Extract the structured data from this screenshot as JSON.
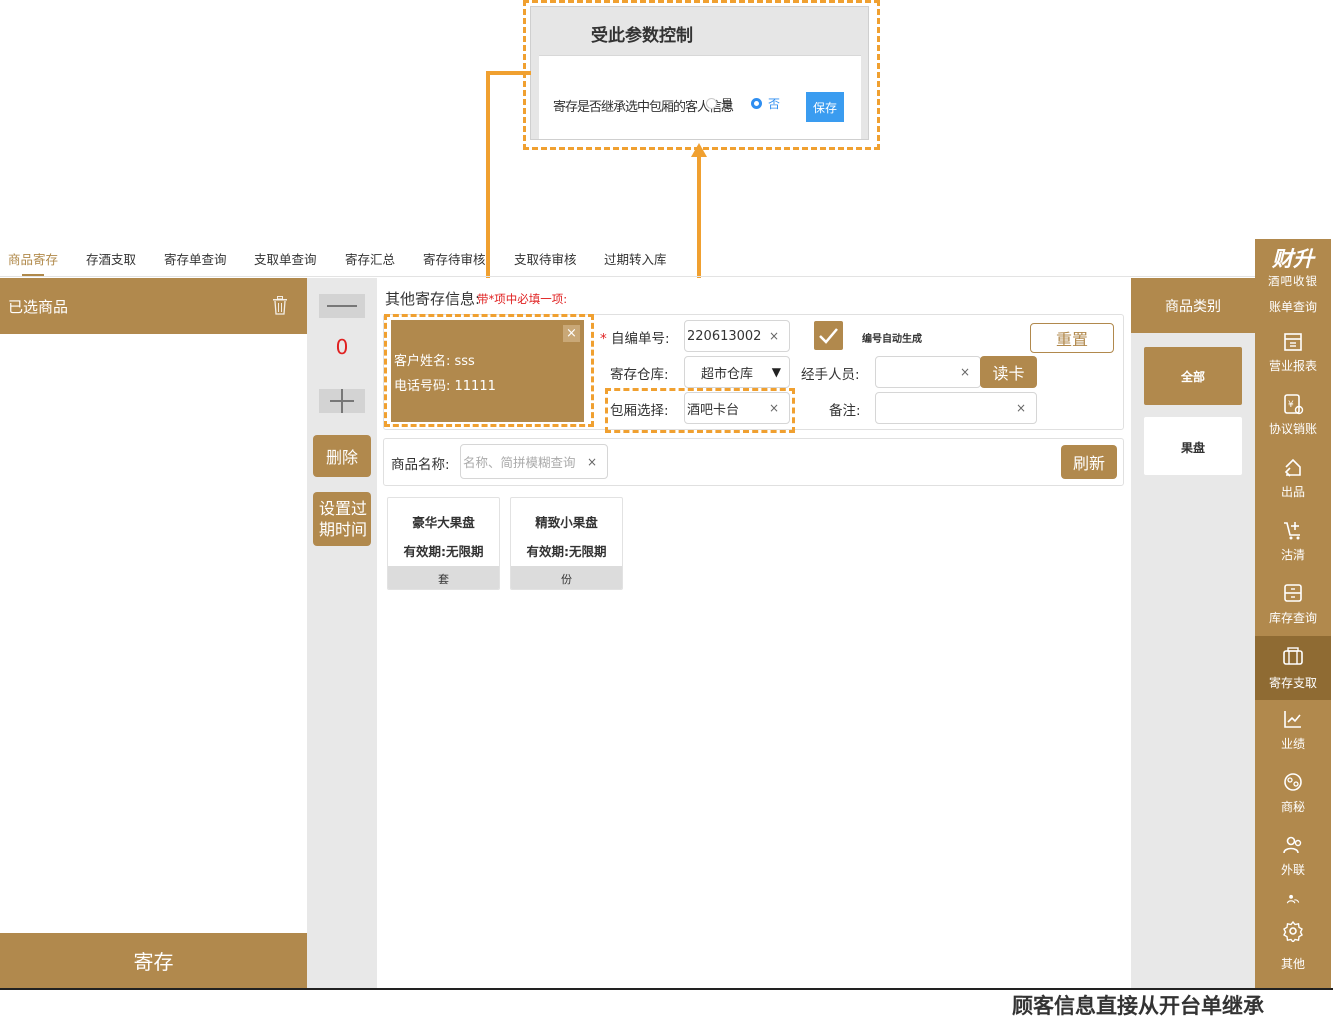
{
  "popup": {
    "title": "受此参数控制",
    "question": "寄存是否继承选中包厢的客人信息",
    "option_yes": "是",
    "option_no": "否",
    "selected": "否",
    "save_label": "保存"
  },
  "tabs": [
    "商品寄存",
    "存酒支取",
    "寄存单查询",
    "支取单查询",
    "寄存汇总",
    "寄存待审核",
    "支取待审核",
    "过期转入库"
  ],
  "active_tab": "商品寄存",
  "left_panel": {
    "title": "已选商品",
    "footer_button": "寄存"
  },
  "quantity": {
    "minus": "—",
    "value": "0",
    "plus": "+"
  },
  "actions": {
    "delete": "删除",
    "set_expire": "设置过期时间"
  },
  "form": {
    "section_title": "其他寄存信息:",
    "hint": "带*项中必填一项:",
    "customer": {
      "name_line": "客户姓名:  sss",
      "phone_line": "电话号码:  11111",
      "close": "×"
    },
    "serial_required": "*",
    "serial_label": "自编单号:",
    "serial_value": "220613002",
    "auto_generate_label": "编号自动生成",
    "auto_generate_checked": true,
    "reset_label": "重置",
    "warehouse_label": "寄存仓库:",
    "warehouse_value": "超市仓库",
    "handler_label": "经手人员:",
    "handler_value": "",
    "read_card_label": "读卡",
    "room_label": "包厢选择:",
    "room_value": "酒吧卡台",
    "note_label": "备注:",
    "note_value": "",
    "clear_symbol": "×",
    "dropdown_symbol": "▼"
  },
  "search": {
    "label": "商品名称:",
    "placeholder": "名称、简拼模糊查询",
    "refresh_label": "刷新"
  },
  "products": [
    {
      "name": "豪华大果盘",
      "expiry": "有效期:无限期",
      "unit": "套"
    },
    {
      "name": "精致小果盘",
      "expiry": "有效期:无限期",
      "unit": "份"
    }
  ],
  "categories": {
    "header": "商品类别",
    "items": [
      "全部",
      "果盘"
    ],
    "selected": "全部"
  },
  "sidebar": {
    "brand": "财升",
    "brand_sub": "酒吧收银",
    "items": [
      {
        "label": "账单查询",
        "icon": "bill-icon"
      },
      {
        "label": "营业报表",
        "icon": "report-icon"
      },
      {
        "label": "协议销账",
        "icon": "agreement-icon"
      },
      {
        "label": "出品",
        "icon": "output-icon"
      },
      {
        "label": "沽清",
        "icon": "soldout-icon"
      },
      {
        "label": "库存查询",
        "icon": "inventory-icon"
      },
      {
        "label": "寄存支取",
        "icon": "storage-icon"
      },
      {
        "label": "业绩",
        "icon": "performance-icon"
      },
      {
        "label": "商秘",
        "icon": "secretary-icon"
      },
      {
        "label": "外联",
        "icon": "contacts-icon"
      },
      {
        "label": "其他",
        "icon": "gear-icon"
      }
    ],
    "active": "寄存支取"
  },
  "caption": "顾客信息直接从开台单继承",
  "colors": {
    "brand_gold": "#b1894d",
    "annotation_orange": "#f0a030",
    "required_red": "#e02020",
    "save_blue": "#3a9cf0"
  }
}
